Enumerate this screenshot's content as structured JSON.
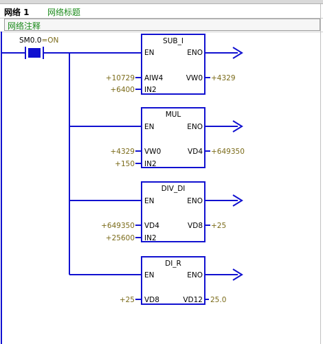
{
  "network": {
    "label": "网络 1",
    "title": "网络标题",
    "comment": "网络注释"
  },
  "contact": {
    "label": "SM0.0",
    "state": "=ON"
  },
  "blocks": [
    {
      "name": "SUB_I",
      "en": "EN",
      "eno": "ENO",
      "in1_pin": "AIW4",
      "in1_value": "+10729",
      "in2_pin": "IN2",
      "in2_value": "+6400",
      "out_pin": "VW0",
      "out_value": "+4329"
    },
    {
      "name": "MUL",
      "en": "EN",
      "eno": "ENO",
      "in1_pin": "VW0",
      "in1_value": "+4329",
      "in2_pin": "IN2",
      "in2_value": "+150",
      "out_pin": "VD4",
      "out_value": "+649350"
    },
    {
      "name": "DIV_DI",
      "en": "EN",
      "eno": "ENO",
      "in1_pin": "VD4",
      "in1_value": "+649350",
      "in2_pin": "IN2",
      "in2_value": "+25600",
      "out_pin": "VD8",
      "out_value": "+25"
    },
    {
      "name": "DI_R",
      "en": "EN",
      "eno": "ENO",
      "in1_pin": "VD8",
      "in1_value": "+25",
      "out_pin": "VD12",
      "out_value": "25.0"
    }
  ],
  "colors": {
    "wire": "#1010d0",
    "value": "#7a6a18",
    "title_green": "#1a8a1a"
  }
}
